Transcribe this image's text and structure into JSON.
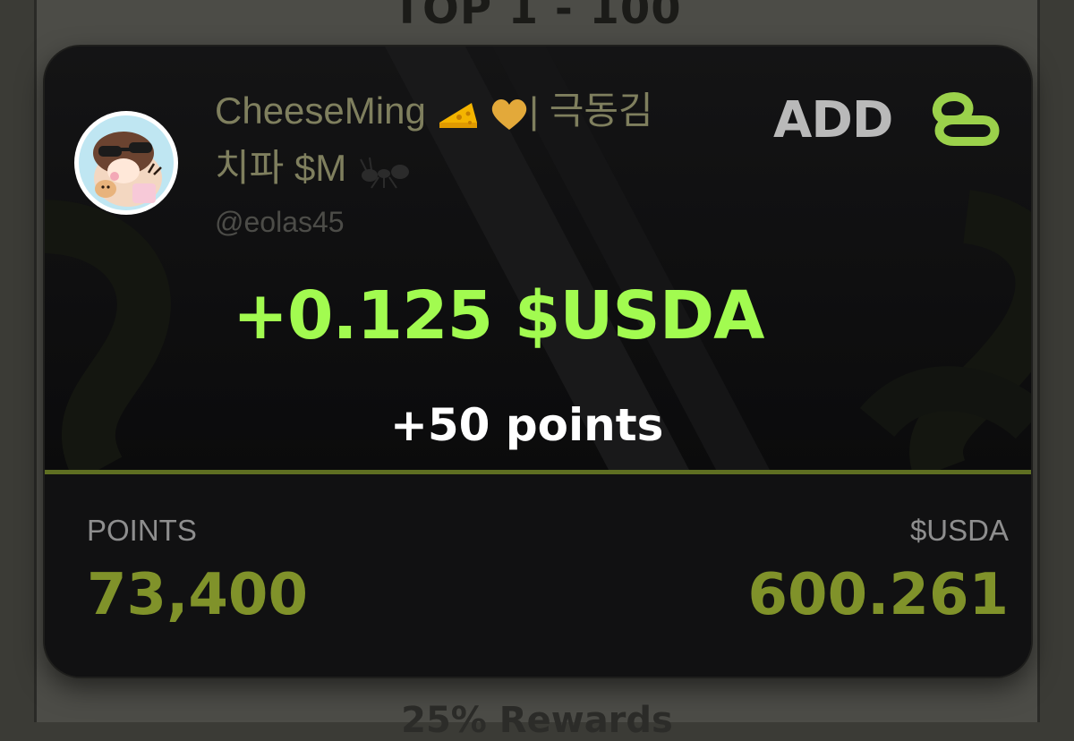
{
  "background": {
    "title": "TOP 1 - 100",
    "footer": "25% Rewards"
  },
  "card": {
    "user": {
      "display_name": "CheeseMing",
      "display_name_suffix": "| 극동김",
      "display_name_line2": "치파 $M",
      "emojis": [
        "cheese-emoji",
        "yellow-heart-emoji",
        "ant-emoji"
      ],
      "handle": "@eolas45"
    },
    "brand": {
      "logo_text": "ADD",
      "logo_icon": "infinity-knot-icon",
      "accent_color": "#a2fb50"
    },
    "reward": {
      "amount": "+0.125 $USDA",
      "points_earned": "+50 points"
    },
    "stats": {
      "points_label": "POINTS",
      "points_value": "73,400",
      "usda_label": "$USDA",
      "usda_value": "600.261",
      "value_color": "#80922a"
    }
  }
}
